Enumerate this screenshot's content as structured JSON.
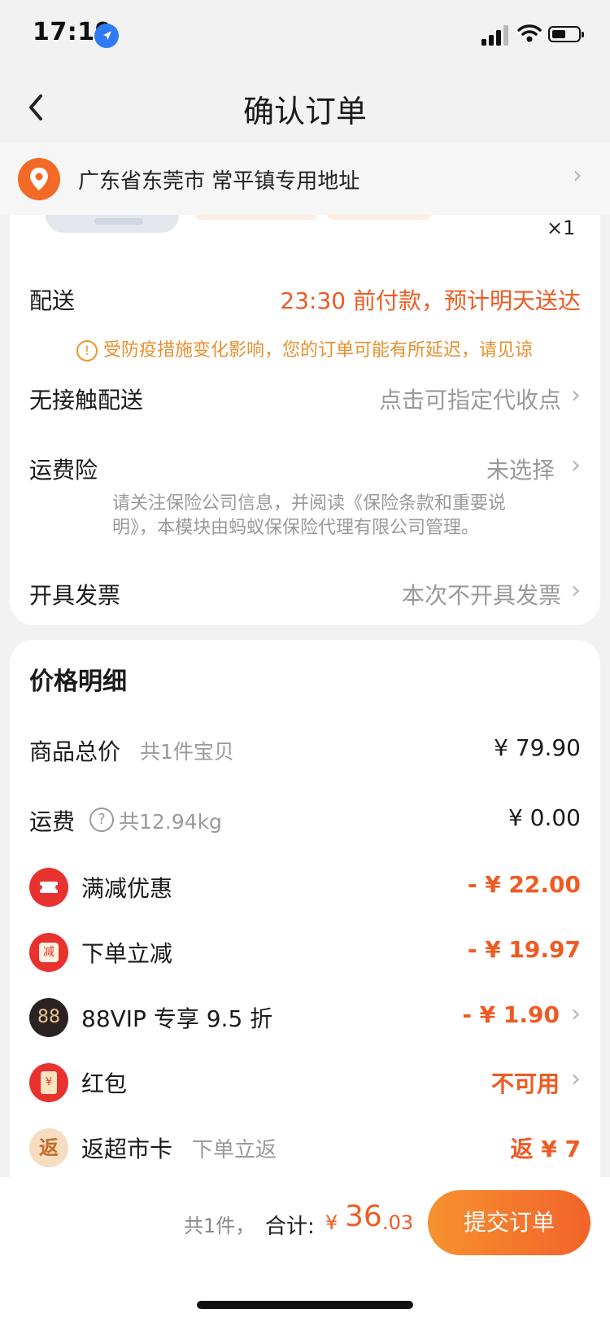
{
  "status_bar": {
    "time": "17:19"
  },
  "nav": {
    "title": "确认订单"
  },
  "address": {
    "text": "广东省东莞市 常平镇专用地址"
  },
  "product": {
    "quantity": "×1"
  },
  "delivery": {
    "label": "配送",
    "value": "23:30 前付款，预计明天送达",
    "notice": "受防疫措施变化影响，您的订单可能有所延迟，请见谅"
  },
  "contactless": {
    "label": "无接触配送",
    "value": "点击可指定代收点"
  },
  "insurance": {
    "label": "运费险",
    "value": "未选择",
    "note_line1": "请关注保险公司信息，并阅读《保险条款和重要说",
    "note_line2": "明》，本模块由蚂蚁保保险代理有限公司管理。"
  },
  "invoice": {
    "label": "开具发票",
    "value": "本次不开具发票"
  },
  "price_detail": {
    "title": "价格明细",
    "goods_total": {
      "label": "商品总价",
      "sub": "共1件宝贝",
      "value": "¥ 79.90"
    },
    "shipping": {
      "label": "运费",
      "sub": "共12.94kg",
      "value": "¥ 0.00"
    },
    "discounts": [
      {
        "label": "满减优惠",
        "value": "- ¥ 22.00",
        "icon": "ticket-icon",
        "icon_text": "",
        "color": "#e8322f"
      },
      {
        "label": "下单立减",
        "value": "- ¥ 19.97",
        "icon": "coupon-icon",
        "icon_text": "减",
        "color": "#e8322f"
      },
      {
        "label": "88VIP 专享 9.5 折",
        "value": "- ¥ 1.90",
        "icon": "vip88-icon",
        "icon_text": "88",
        "color": "#2b2321"
      },
      {
        "label": "红包",
        "value": "不可用",
        "icon": "red-envelope-icon",
        "icon_text": "¥",
        "color": "#e8322f"
      },
      {
        "label": "返超市卡",
        "sub": "下单立返",
        "value": "返 ¥ 7",
        "icon": "rebate-icon",
        "icon_text": "返",
        "color": "#f6dcc0"
      }
    ]
  },
  "footer": {
    "count_label": "共1件，",
    "total_label": "合计:",
    "currency": "¥",
    "total_int": "36",
    "total_dec": ".03",
    "submit_label": "提交订单"
  },
  "colors": {
    "accent": "#f05a22",
    "submit_gradient_start": "#f7912f",
    "submit_gradient_end": "#f2632a"
  }
}
